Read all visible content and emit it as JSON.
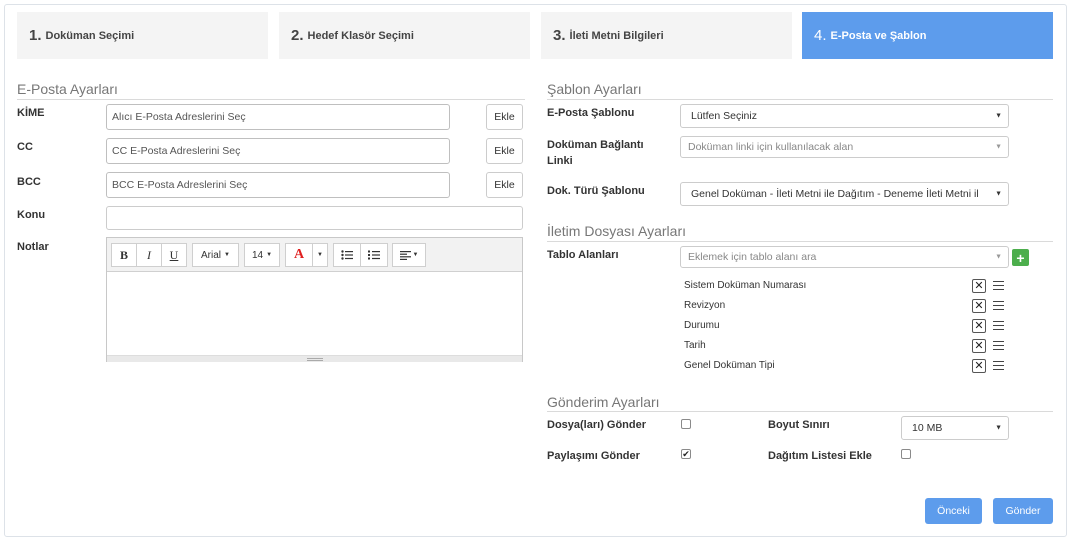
{
  "steps": [
    {
      "num": "1.",
      "label": "Doküman Seçimi"
    },
    {
      "num": "2.",
      "label": "Hedef Klasör Seçimi"
    },
    {
      "num": "3.",
      "label": "İleti Metni Bilgileri"
    },
    {
      "num": "4.",
      "label": "E-Posta ve Şablon"
    }
  ],
  "email_settings": {
    "title": "E-Posta Ayarları",
    "kime_label": "KİME",
    "kime_placeholder": "Alıcı E-Posta Adreslerini Seç",
    "cc_label": "CC",
    "cc_placeholder": "CC E-Posta Adreslerini Seç",
    "bcc_label": "BCC",
    "bcc_placeholder": "BCC E-Posta Adreslerini Seç",
    "add_label": "Ekle",
    "konu_label": "Konu",
    "konu_value": "",
    "notlar_label": "Notlar"
  },
  "editor_toolbar": {
    "bold": "B",
    "italic": "I",
    "underline": "U",
    "font": "Arial",
    "size": "14",
    "color_glyph": "A"
  },
  "template_settings": {
    "title": "Şablon Ayarları",
    "email_template_label": "E-Posta Şablonu",
    "email_template_value": "Lütfen Seçiniz",
    "doc_link_label_line1": "Doküman Bağlantı",
    "doc_link_label_line2": "Linki",
    "doc_link_placeholder": "Doküman linki için kullanılacak alan",
    "doc_type_label": "Dok. Türü Şablonu",
    "doc_type_value": "Genel Doküman - İleti Metni ile Dağıtım - Deneme İleti Metni il"
  },
  "message_file_settings": {
    "title": "İletim Dosyası Ayarları",
    "table_fields_label": "Tablo Alanları",
    "table_fields_placeholder": "Eklemek için tablo alanı ara",
    "fields": [
      "Sistem Doküman Numarası",
      "Revizyon",
      "Durumu",
      "Tarih",
      "Genel Doküman Tipi"
    ]
  },
  "send_settings": {
    "title": "Gönderim Ayarları",
    "send_files_label": "Dosya(ları) Gönder",
    "send_files_checked": false,
    "size_limit_label": "Boyut Sınırı",
    "size_limit_value": "10 MB",
    "send_share_label": "Paylaşımı Gönder",
    "send_share_checked": true,
    "add_dist_list_label": "Dağıtım Listesi Ekle",
    "add_dist_list_checked": false
  },
  "footer": {
    "prev_label": "Önceki",
    "send_label": "Gönder"
  },
  "colors": {
    "active_step": "#5d9cec",
    "primary_button": "#5d9cec",
    "add_field_button": "#4cae4c",
    "font_color_red": "#e02020"
  }
}
